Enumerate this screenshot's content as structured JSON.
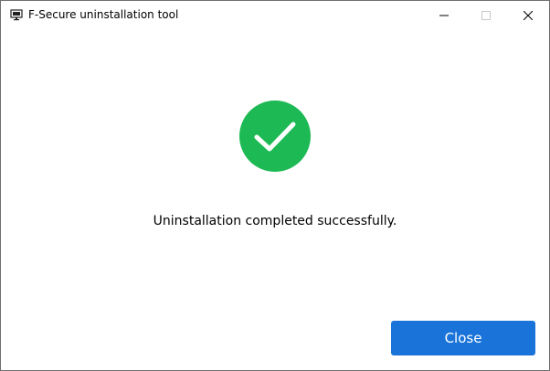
{
  "window": {
    "title": "F-Secure uninstallation tool"
  },
  "titlebar": {
    "icons": [
      "computer-icon"
    ],
    "controls": [
      "minimize-icon",
      "maximize-icon",
      "close-icon"
    ]
  },
  "status": {
    "icon": "checkmark-icon",
    "color": "#1db954",
    "message": "Uninstallation completed successfully."
  },
  "actions": {
    "close_label": "Close",
    "close_color": "#1a73d8"
  }
}
